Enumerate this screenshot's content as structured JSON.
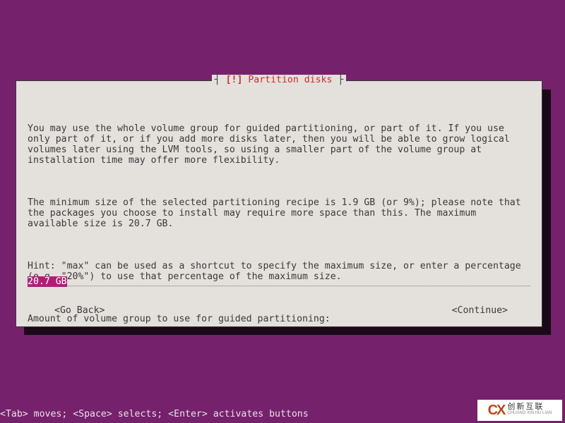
{
  "dialog": {
    "title_bang": "[!]",
    "title_text": "Partition disks",
    "para1": "You may use the whole volume group for guided partitioning, or part of it. If you use only part of it, or if you add more disks later, then you will be able to grow logical volumes later using the LVM tools, so using a smaller part of the volume group at installation time may offer more flexibility.",
    "para2": "The minimum size of the selected partitioning recipe is 1.9 GB (or 9%); please note that the packages you choose to install may require more space than this. The maximum available size is 20.7 GB.",
    "para3": "Hint: \"max\" can be used as a shortcut to specify the maximum size, or enter a percentage (e.g. \"20%\") to use that percentage of the maximum size.",
    "prompt": "Amount of volume group to use for guided partitioning:",
    "input_value": "20.7 GB",
    "go_back": "<Go Back>",
    "continue": "<Continue>"
  },
  "helpbar": "<Tab> moves; <Space> selects; <Enter> activates buttons",
  "watermark": {
    "logo": "CX",
    "name": "创新互联",
    "sub": "CHUANG XIN HU LIAN"
  }
}
